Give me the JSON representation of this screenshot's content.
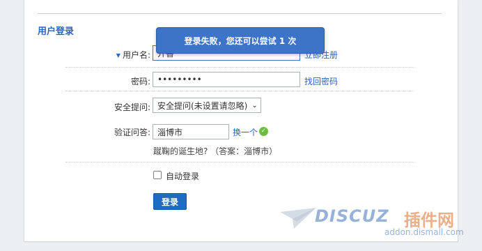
{
  "section_title": "用户登录",
  "toast": "登录失败，您还可以尝试 1 次",
  "form": {
    "username_label": "用户名:",
    "username_value": "开香",
    "register_link": "立即注册",
    "password_label": "密码:",
    "password_value": "•••••••••",
    "forgot_link": "找回密码",
    "security_label": "安全提问:",
    "security_selected": "安全提问(未设置请忽略)",
    "captcha_label": "验证问答:",
    "captcha_value": "淄博市",
    "refresh_link": "换一个",
    "captcha_hint": "蹴鞠的诞生地? （答案：淄博市）",
    "remember_label": "自动登录",
    "login_button": "登录"
  },
  "watermark": {
    "brand": "DISCUZ",
    "cn": "插件网",
    "domain": "addon.dismall.com"
  },
  "colors": {
    "accent": "#2b66b8",
    "toast_bg": "#3d74c8",
    "button_bg": "#1e6bc4",
    "check_green": "#6cbf3c"
  }
}
